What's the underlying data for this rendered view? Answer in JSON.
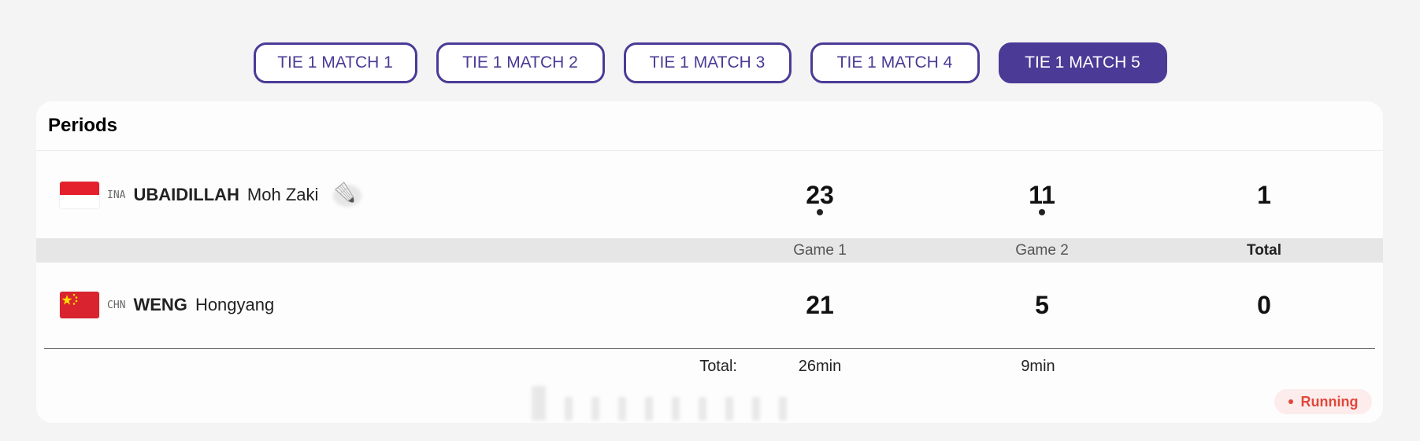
{
  "tabs": [
    {
      "label": "TIE 1 MATCH 1",
      "active": false
    },
    {
      "label": "TIE 1 MATCH 2",
      "active": false
    },
    {
      "label": "TIE 1 MATCH 3",
      "active": false
    },
    {
      "label": "TIE 1 MATCH 4",
      "active": false
    },
    {
      "label": "TIE 1 MATCH 5",
      "active": true
    }
  ],
  "periods": {
    "title": "Periods",
    "player1": {
      "country": "INA",
      "surname": "UBAIDILLAH",
      "given_name": "Moh Zaki",
      "serving": true,
      "scores": {
        "game1": "23",
        "game2": "11",
        "total": "1"
      },
      "game_won_markers": {
        "game1": true,
        "game2": true
      }
    },
    "player2": {
      "country": "CHN",
      "surname": "WENG",
      "given_name": "Hongyang",
      "serving": false,
      "scores": {
        "game1": "21",
        "game2": "5",
        "total": "0"
      }
    },
    "columns": {
      "game1": "Game 1",
      "game2": "Game 2",
      "total": "Total"
    },
    "durations": {
      "label": "Total:",
      "game1": "26min",
      "game2": "9min"
    },
    "status": "Running",
    "colors": {
      "accent": "#4b3a96",
      "running": "#e1473b",
      "ina_red": "#e4202c",
      "chn_red": "#d9232e"
    }
  }
}
